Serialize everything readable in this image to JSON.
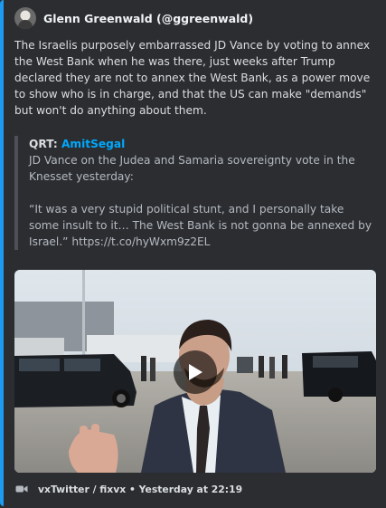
{
  "embed": {
    "accent_color": "#1d9bf0",
    "author": {
      "name": "Glenn Greenwald (@ggreenwald)",
      "avatar_icon": "avatar-photo"
    },
    "description": "The Israelis purposely embarrassed JD Vance by voting to annex the West Bank when he was there, just weeks after Trump declared they are not to annex the West Bank, as a power move to show who is in charge, and that the US can make \"demands\" but won't do anything about them.",
    "quote": {
      "prefix": "QRT: ",
      "handle": "AmitSegal",
      "line1": "JD Vance on the Judea and Samaria sovereignty vote in the Knesset yesterday:",
      "line2": "“It was a very stupid political stunt, and I personally take some insult to it… The West Bank is not gonna be annexed by Israel.” https://t.co/hyWxm9z2EL"
    },
    "media": {
      "type": "video",
      "play_icon": "play-icon"
    },
    "footer": {
      "icon": "video-camera-icon",
      "text": "vxTwitter / fixvx • Yesterday at 22:19"
    }
  }
}
